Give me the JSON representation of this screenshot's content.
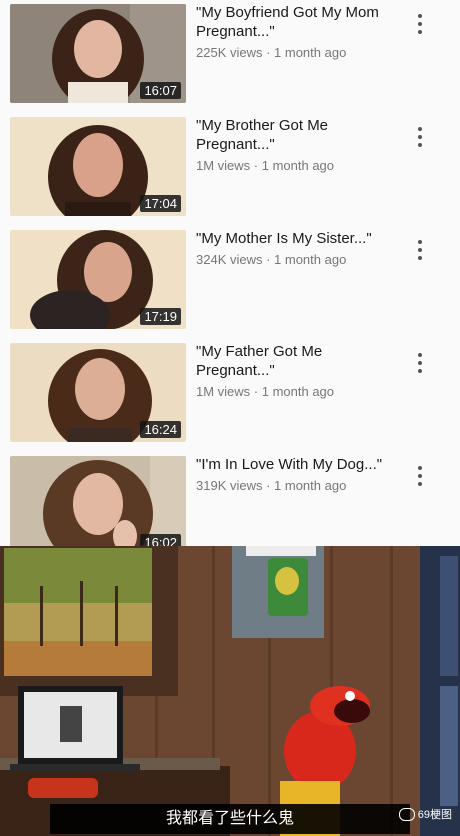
{
  "videos": [
    {
      "title": "\"My Boyfriend Got My Mom Pregnant...\"",
      "views": "225K views · 1 month ago",
      "duration": "16:07"
    },
    {
      "title": "\"My Brother Got Me Pregnant...\"",
      "views": "1M views · 1 month ago",
      "duration": "17:04"
    },
    {
      "title": "\"My Mother Is My Sister...\"",
      "views": "324K views · 1 month ago",
      "duration": "17:19"
    },
    {
      "title": "\"My Father Got Me Pregnant...\"",
      "views": "1M views · 1 month ago",
      "duration": "16:24"
    },
    {
      "title": "\"I'm In Love With My Dog...\"",
      "views": "319K views · 1 month ago",
      "duration": "16:02"
    }
  ],
  "meme": {
    "caption": "我都看了些什么鬼",
    "watermark": "69梗图"
  }
}
